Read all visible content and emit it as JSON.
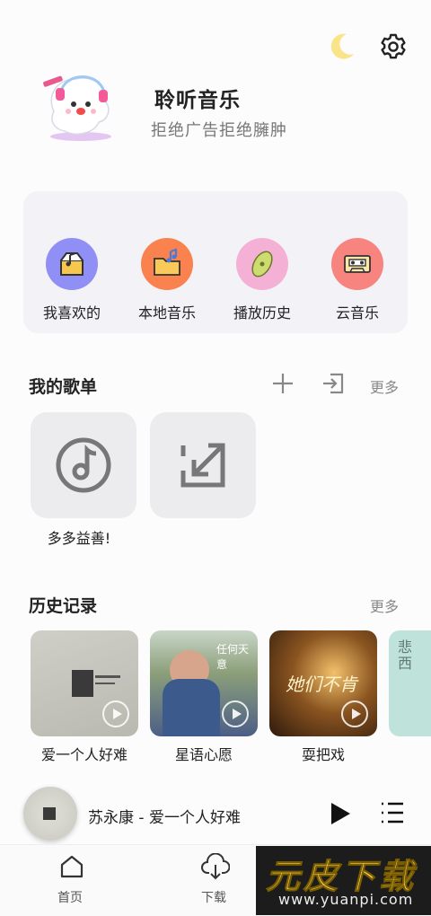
{
  "header": {
    "title": "聆听音乐",
    "subtitle": "拒绝广告拒绝臃肿"
  },
  "quick_access": [
    {
      "label": "我喜欢的",
      "icon": "music-box-icon",
      "color": "#8f8ff5"
    },
    {
      "label": "本地音乐",
      "icon": "folder-music-icon",
      "color": "#f9824e"
    },
    {
      "label": "播放历史",
      "icon": "record-icon",
      "color": "#f4b1d5"
    },
    {
      "label": "云音乐",
      "icon": "cassette-icon",
      "color": "#f7847e"
    }
  ],
  "playlists": {
    "title": "我的歌单",
    "more": "更多",
    "items": [
      {
        "name": "多多益善!"
      }
    ]
  },
  "history": {
    "title": "历史记录",
    "more": "更多",
    "items": [
      {
        "name": "爱一个人好难"
      },
      {
        "name": "星语心愿"
      },
      {
        "name": "耍把戏"
      }
    ],
    "album_text": {
      "star": "任何天意",
      "play": "她们不肯",
      "cut": "悲西"
    }
  },
  "player": {
    "now_playing": "苏永康 - 爱一个人好难"
  },
  "tabs": [
    {
      "label": "首页"
    },
    {
      "label": "下载"
    }
  ],
  "watermark": {
    "title": "元皮下载",
    "url": "www.yuanpi.com"
  }
}
